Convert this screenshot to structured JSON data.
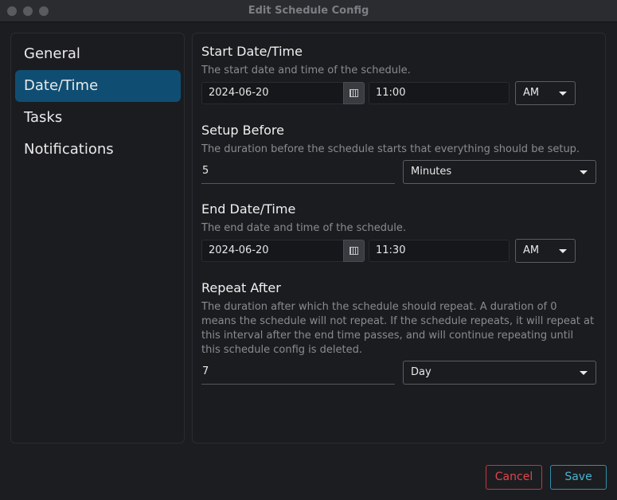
{
  "window": {
    "title": "Edit Schedule Config"
  },
  "sidebar": {
    "items": [
      {
        "label": "General"
      },
      {
        "label": "Date/Time"
      },
      {
        "label": "Tasks"
      },
      {
        "label": "Notifications"
      }
    ],
    "active_index": 1
  },
  "start": {
    "title": "Start Date/Time",
    "desc": "The start date and time of the schedule.",
    "date": "2024-06-20",
    "time": "11:00",
    "ampm": "AM"
  },
  "setup": {
    "title": "Setup Before",
    "desc": "The duration before the schedule starts that everything should be setup.",
    "value": "5",
    "unit": "Minutes"
  },
  "end": {
    "title": "End Date/Time",
    "desc": "The end date and time of the schedule.",
    "date": "2024-06-20",
    "time": "11:30",
    "ampm": "AM"
  },
  "repeat": {
    "title": "Repeat After",
    "desc_lines": [
      "The duration after which the schedule should repeat. A duration of 0",
      "means the schedule will not repeat. If the schedule repeats, it will repeat at",
      "this interval after the end time passes, and will continue repeating until",
      "this schedule config is deleted."
    ],
    "value": "7",
    "unit": "Day"
  },
  "footer": {
    "cancel_label": "Cancel",
    "save_label": "Save"
  },
  "colors": {
    "accent": "#0f4e72",
    "cancel": "#e0454b",
    "save": "#49b2cf"
  }
}
